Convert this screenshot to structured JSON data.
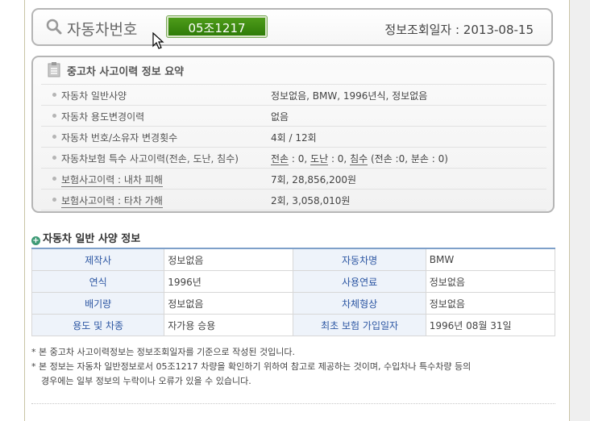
{
  "header": {
    "title": "자동차번호",
    "plate_number": "05조1217",
    "inquiry_date": "정보조회일자 : 2013-08-15"
  },
  "summary": {
    "title": "중고차 사고이력 정보 요약",
    "rows": [
      {
        "label": "자동차 일반사양",
        "value": "정보없음, BMW, 1996년식, 정보없음"
      },
      {
        "label": "자동차 용도변경이력",
        "value": "없음"
      },
      {
        "label": "자동차 번호/소유자 변경횟수",
        "value": "4회 / 12회"
      },
      {
        "label": "자동차보험 특수 사고이력(전손, 도난, 침수)",
        "value": ""
      },
      {
        "label": "보험사고이력 : 내차 피해",
        "value": "7회, 28,856,200원"
      },
      {
        "label": "보험사고이력 : 타차 가해",
        "value": "2회, 3,058,010원"
      }
    ],
    "special": {
      "total_loss_label": "전손",
      "total_loss_value": " : 0, ",
      "theft_label": "도난",
      "theft_value": " : 0, ",
      "flood_label": "침수",
      "flood_value": " (전손 :0, 분손 : 0)"
    }
  },
  "spec": {
    "title": "자동차 일반 사양 정보",
    "rows": [
      {
        "l1": "제작사",
        "v1": "정보없음",
        "l2": "자동차명",
        "v2": "BMW"
      },
      {
        "l1": "연식",
        "v1": "1996년",
        "l2": "사용연료",
        "v2": "정보없음"
      },
      {
        "l1": "배기량",
        "v1": "정보없음",
        "l2": "차체형상",
        "v2": "정보없음"
      },
      {
        "l1": "용도 및 차종",
        "v1": "자가용 승용",
        "l2": "최초 보험 가입일자",
        "v2": "1996년 08월 31일"
      }
    ]
  },
  "notes": [
    "* 본 중고차 사고이력정보는 정보조회일자를 기준으로 작성된 것입니다.",
    "* 본 정보는 자동차 일반정보로서 05조1217 차량을 확인하기 위하여 참고로 제공하는 것이며, 수입차나 특수차량 등의",
    "경우에는 일부 정보의 누락이나 오류가 있을 수 있습니다."
  ],
  "icons": [
    "search-icon",
    "clipboard-icon",
    "mouse-cursor-icon",
    "plus-circle-icon"
  ],
  "colors": {
    "plate_green": "#2f7c08",
    "header_text_blue": "#2d57a3",
    "table_top_border": "#7ea0c9"
  }
}
